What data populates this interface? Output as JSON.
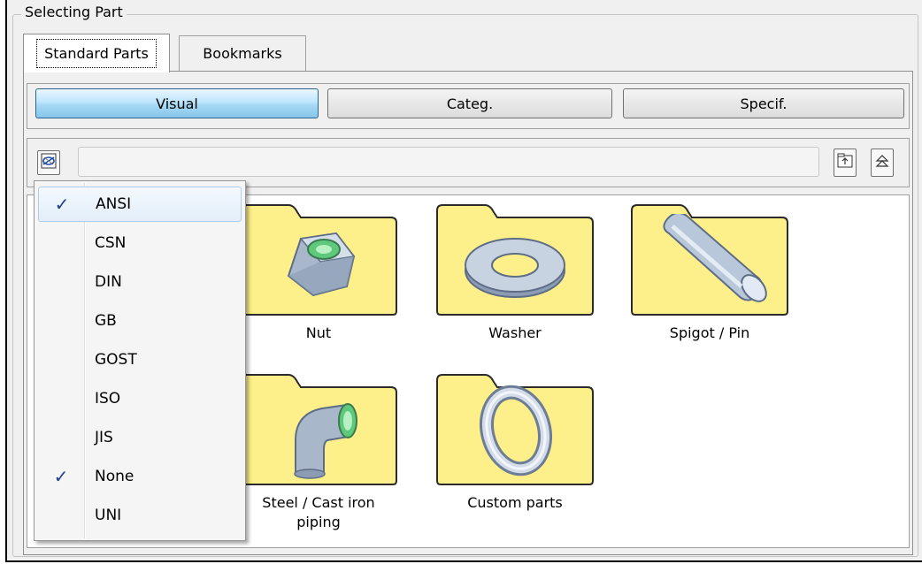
{
  "panel": {
    "title": "Selecting Part"
  },
  "tabs": [
    {
      "label": "Standard Parts",
      "active": true
    },
    {
      "label": "Bookmarks",
      "active": false
    }
  ],
  "modes": [
    {
      "label": "Visual",
      "active": true
    },
    {
      "label": "Categ.",
      "active": false
    },
    {
      "label": "Specif.",
      "active": false
    }
  ],
  "nav": {
    "path_value": "",
    "standard_filter_icon": "standard-filter-icon",
    "up_folder_icon": "folder-up-icon",
    "top_level_icon": "collapse-all-icon"
  },
  "folders": [
    {
      "label": "Nut",
      "icon": "hex-nut-icon"
    },
    {
      "label": "Washer",
      "icon": "washer-icon"
    },
    {
      "label": "Spigot / Pin",
      "icon": "pin-icon"
    },
    {
      "label": "Steel / Cast iron piping",
      "icon": "pipe-elbow-icon"
    },
    {
      "label": "Custom parts",
      "icon": "torus-icon"
    }
  ],
  "standards_menu": {
    "items": [
      {
        "label": "ANSI",
        "checked": true,
        "highlighted": true
      },
      {
        "label": "CSN",
        "checked": false
      },
      {
        "label": "DIN",
        "checked": false
      },
      {
        "label": "GB",
        "checked": false
      },
      {
        "label": "GOST",
        "checked": false
      },
      {
        "label": "ISO",
        "checked": false
      },
      {
        "label": "JIS",
        "checked": false
      },
      {
        "label": "None",
        "checked": true
      },
      {
        "label": "UNI",
        "checked": false
      }
    ],
    "check_glyph": "✓"
  },
  "colors": {
    "folder_fill": "#fdf08a",
    "folder_stroke": "#2b2b2b",
    "active_mode": "#a7d9f5",
    "check": "#1f3e8f"
  }
}
